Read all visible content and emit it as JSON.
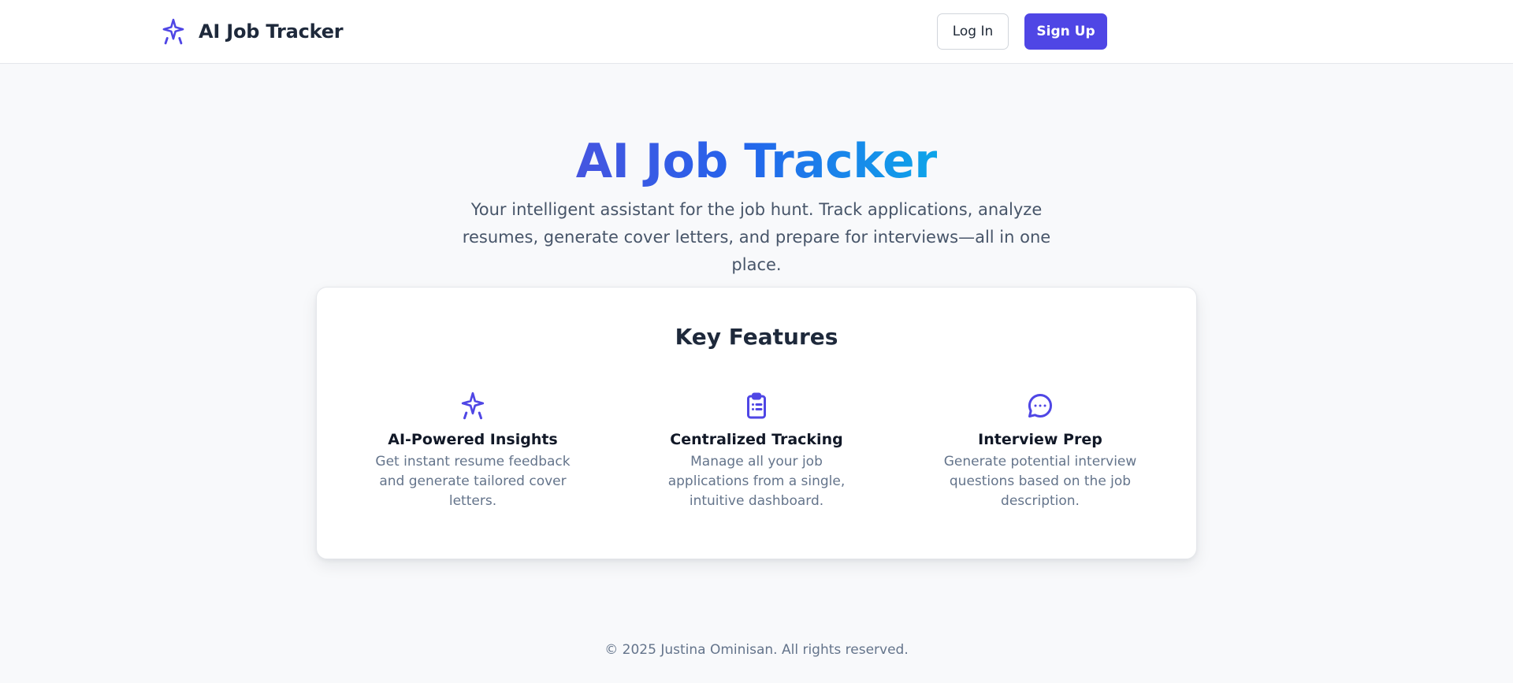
{
  "nav": {
    "brand": "AI Job Tracker",
    "login_label": "Log In",
    "signup_label": "Sign Up"
  },
  "hero": {
    "title": "AI Job Tracker",
    "subtitle": "Your intelligent assistant for the job hunt. Track applications, analyze resumes, generate cover letters, and prepare for interviews—all in one place."
  },
  "features": {
    "heading": "Key Features",
    "items": [
      {
        "icon": "sparkles-icon",
        "title": "AI-Powered Insights",
        "description": "Get instant resume feedback and generate tailored cover letters."
      },
      {
        "icon": "clipboard-list-icon",
        "title": "Centralized Tracking",
        "description": "Manage all your job applications from a single, intuitive dashboard."
      },
      {
        "icon": "chat-bubble-icon",
        "title": "Interview Prep",
        "description": "Generate potential interview questions based on the job description."
      }
    ]
  },
  "footer": {
    "copyright": "© 2025 Justina Ominisan. All rights reserved."
  },
  "colors": {
    "accent": "#4f46e5",
    "gradient_start": "#4655e0",
    "gradient_end": "#0ea5e9",
    "background": "#f8f9fb"
  }
}
